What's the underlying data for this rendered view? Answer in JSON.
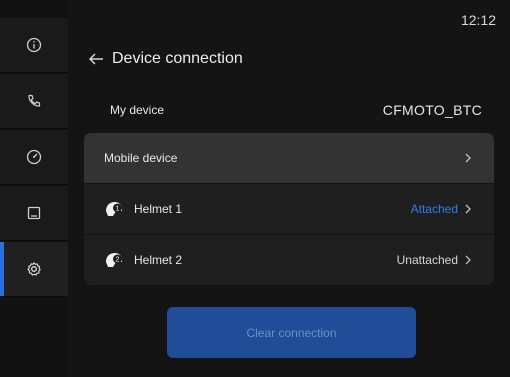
{
  "status": {
    "time": "12:12"
  },
  "header": {
    "title": "Device connection"
  },
  "my_device": {
    "label": "My device",
    "value": "CFMOTO_BTC"
  },
  "rows": [
    {
      "label": "Mobile device",
      "status": ""
    },
    {
      "label": "Helmet 1",
      "status": "Attached",
      "badge": "1"
    },
    {
      "label": "Helmet 2",
      "status": "Unattached",
      "badge": "2"
    }
  ],
  "actions": {
    "clear_label": "Clear connection"
  },
  "sidebar": {
    "items": [
      {
        "icon": "info-icon"
      },
      {
        "icon": "phone-icon"
      },
      {
        "icon": "gauge-icon"
      },
      {
        "icon": "screen-icon"
      },
      {
        "icon": "settings-icon",
        "active": true
      }
    ]
  },
  "colors": {
    "accent": "#2a6fe0",
    "attached": "#2c7ef0",
    "button": "#204c98"
  }
}
